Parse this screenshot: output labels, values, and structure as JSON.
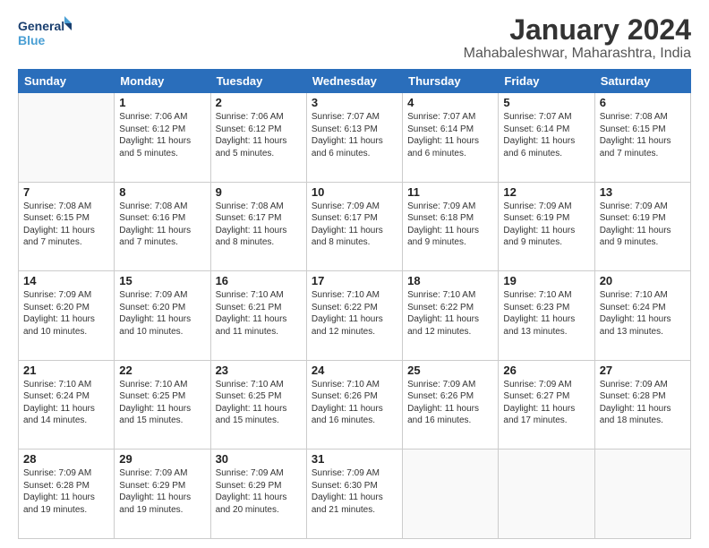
{
  "logo": {
    "line1": "General",
    "line2": "Blue"
  },
  "title": "January 2024",
  "location": "Mahabaleshwar, Maharashtra, India",
  "weekdays": [
    "Sunday",
    "Monday",
    "Tuesday",
    "Wednesday",
    "Thursday",
    "Friday",
    "Saturday"
  ],
  "weeks": [
    [
      {
        "day": "",
        "info": ""
      },
      {
        "day": "1",
        "info": "Sunrise: 7:06 AM\nSunset: 6:12 PM\nDaylight: 11 hours\nand 5 minutes."
      },
      {
        "day": "2",
        "info": "Sunrise: 7:06 AM\nSunset: 6:12 PM\nDaylight: 11 hours\nand 5 minutes."
      },
      {
        "day": "3",
        "info": "Sunrise: 7:07 AM\nSunset: 6:13 PM\nDaylight: 11 hours\nand 6 minutes."
      },
      {
        "day": "4",
        "info": "Sunrise: 7:07 AM\nSunset: 6:14 PM\nDaylight: 11 hours\nand 6 minutes."
      },
      {
        "day": "5",
        "info": "Sunrise: 7:07 AM\nSunset: 6:14 PM\nDaylight: 11 hours\nand 6 minutes."
      },
      {
        "day": "6",
        "info": "Sunrise: 7:08 AM\nSunset: 6:15 PM\nDaylight: 11 hours\nand 7 minutes."
      }
    ],
    [
      {
        "day": "7",
        "info": "Sunrise: 7:08 AM\nSunset: 6:15 PM\nDaylight: 11 hours\nand 7 minutes."
      },
      {
        "day": "8",
        "info": "Sunrise: 7:08 AM\nSunset: 6:16 PM\nDaylight: 11 hours\nand 7 minutes."
      },
      {
        "day": "9",
        "info": "Sunrise: 7:08 AM\nSunset: 6:17 PM\nDaylight: 11 hours\nand 8 minutes."
      },
      {
        "day": "10",
        "info": "Sunrise: 7:09 AM\nSunset: 6:17 PM\nDaylight: 11 hours\nand 8 minutes."
      },
      {
        "day": "11",
        "info": "Sunrise: 7:09 AM\nSunset: 6:18 PM\nDaylight: 11 hours\nand 9 minutes."
      },
      {
        "day": "12",
        "info": "Sunrise: 7:09 AM\nSunset: 6:19 PM\nDaylight: 11 hours\nand 9 minutes."
      },
      {
        "day": "13",
        "info": "Sunrise: 7:09 AM\nSunset: 6:19 PM\nDaylight: 11 hours\nand 9 minutes."
      }
    ],
    [
      {
        "day": "14",
        "info": "Sunrise: 7:09 AM\nSunset: 6:20 PM\nDaylight: 11 hours\nand 10 minutes."
      },
      {
        "day": "15",
        "info": "Sunrise: 7:09 AM\nSunset: 6:20 PM\nDaylight: 11 hours\nand 10 minutes."
      },
      {
        "day": "16",
        "info": "Sunrise: 7:10 AM\nSunset: 6:21 PM\nDaylight: 11 hours\nand 11 minutes."
      },
      {
        "day": "17",
        "info": "Sunrise: 7:10 AM\nSunset: 6:22 PM\nDaylight: 11 hours\nand 12 minutes."
      },
      {
        "day": "18",
        "info": "Sunrise: 7:10 AM\nSunset: 6:22 PM\nDaylight: 11 hours\nand 12 minutes."
      },
      {
        "day": "19",
        "info": "Sunrise: 7:10 AM\nSunset: 6:23 PM\nDaylight: 11 hours\nand 13 minutes."
      },
      {
        "day": "20",
        "info": "Sunrise: 7:10 AM\nSunset: 6:24 PM\nDaylight: 11 hours\nand 13 minutes."
      }
    ],
    [
      {
        "day": "21",
        "info": "Sunrise: 7:10 AM\nSunset: 6:24 PM\nDaylight: 11 hours\nand 14 minutes."
      },
      {
        "day": "22",
        "info": "Sunrise: 7:10 AM\nSunset: 6:25 PM\nDaylight: 11 hours\nand 15 minutes."
      },
      {
        "day": "23",
        "info": "Sunrise: 7:10 AM\nSunset: 6:25 PM\nDaylight: 11 hours\nand 15 minutes."
      },
      {
        "day": "24",
        "info": "Sunrise: 7:10 AM\nSunset: 6:26 PM\nDaylight: 11 hours\nand 16 minutes."
      },
      {
        "day": "25",
        "info": "Sunrise: 7:09 AM\nSunset: 6:26 PM\nDaylight: 11 hours\nand 16 minutes."
      },
      {
        "day": "26",
        "info": "Sunrise: 7:09 AM\nSunset: 6:27 PM\nDaylight: 11 hours\nand 17 minutes."
      },
      {
        "day": "27",
        "info": "Sunrise: 7:09 AM\nSunset: 6:28 PM\nDaylight: 11 hours\nand 18 minutes."
      }
    ],
    [
      {
        "day": "28",
        "info": "Sunrise: 7:09 AM\nSunset: 6:28 PM\nDaylight: 11 hours\nand 19 minutes."
      },
      {
        "day": "29",
        "info": "Sunrise: 7:09 AM\nSunset: 6:29 PM\nDaylight: 11 hours\nand 19 minutes."
      },
      {
        "day": "30",
        "info": "Sunrise: 7:09 AM\nSunset: 6:29 PM\nDaylight: 11 hours\nand 20 minutes."
      },
      {
        "day": "31",
        "info": "Sunrise: 7:09 AM\nSunset: 6:30 PM\nDaylight: 11 hours\nand 21 minutes."
      },
      {
        "day": "",
        "info": ""
      },
      {
        "day": "",
        "info": ""
      },
      {
        "day": "",
        "info": ""
      }
    ]
  ]
}
